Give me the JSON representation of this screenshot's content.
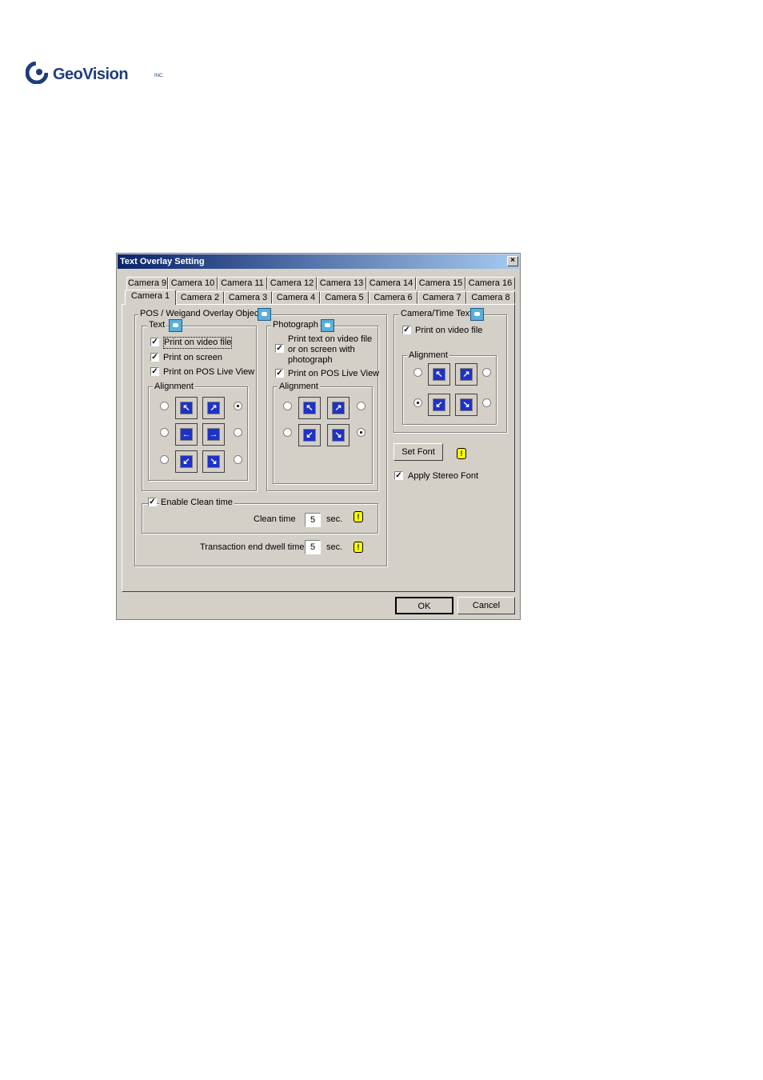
{
  "logo": {
    "text": "GeoVision",
    "tm": "INC."
  },
  "dialog": {
    "title": "Text Overlay Setting",
    "tabs_row1": [
      "Camera 9",
      "Camera 10",
      "Camera 11",
      "Camera 12",
      "Camera 13",
      "Camera 14",
      "Camera 15",
      "Camera 16"
    ],
    "tabs_row2": [
      "Camera 1",
      "Camera 2",
      "Camera 3",
      "Camera 4",
      "Camera 5",
      "Camera 6",
      "Camera 7",
      "Camera 8"
    ],
    "active_tab": "Camera 1",
    "pos_group": {
      "label": "POS / Weigand Overlay Object",
      "text_group": {
        "label": "Text",
        "checks": [
          {
            "label": "Print on video file",
            "checked": true
          },
          {
            "label": "Print on screen",
            "checked": true
          },
          {
            "label": "Print on POS Live View",
            "checked": true
          }
        ],
        "alignment_label": "Alignment"
      },
      "photo_group": {
        "label": "Photograph",
        "checks": [
          {
            "label": "Print text on video file or on screen with photograph",
            "checked": true,
            "lines": [
              "Print text on video file",
              "or on screen with",
              "photograph"
            ]
          },
          {
            "label": "Print on POS Live View",
            "checked": true
          }
        ],
        "alignment_label": "Alignment"
      },
      "clean": {
        "enable_label": "Enable Clean time",
        "enabled": true,
        "clean_time_label": "Clean time",
        "clean_time_value": "5",
        "unit": "sec."
      },
      "dwell": {
        "label": "Transaction end dwell time",
        "value": "5",
        "unit": "sec."
      }
    },
    "camera_time": {
      "label": "Camera/Time Text",
      "check": {
        "label": "Print on video file",
        "checked": true
      },
      "alignment_label": "Alignment"
    },
    "set_font_label": "Set Font",
    "stereo": {
      "label": "Apply Stereo Font",
      "checked": true
    },
    "ok_label": "OK",
    "cancel_label": "Cancel",
    "check_mark": "✓"
  }
}
